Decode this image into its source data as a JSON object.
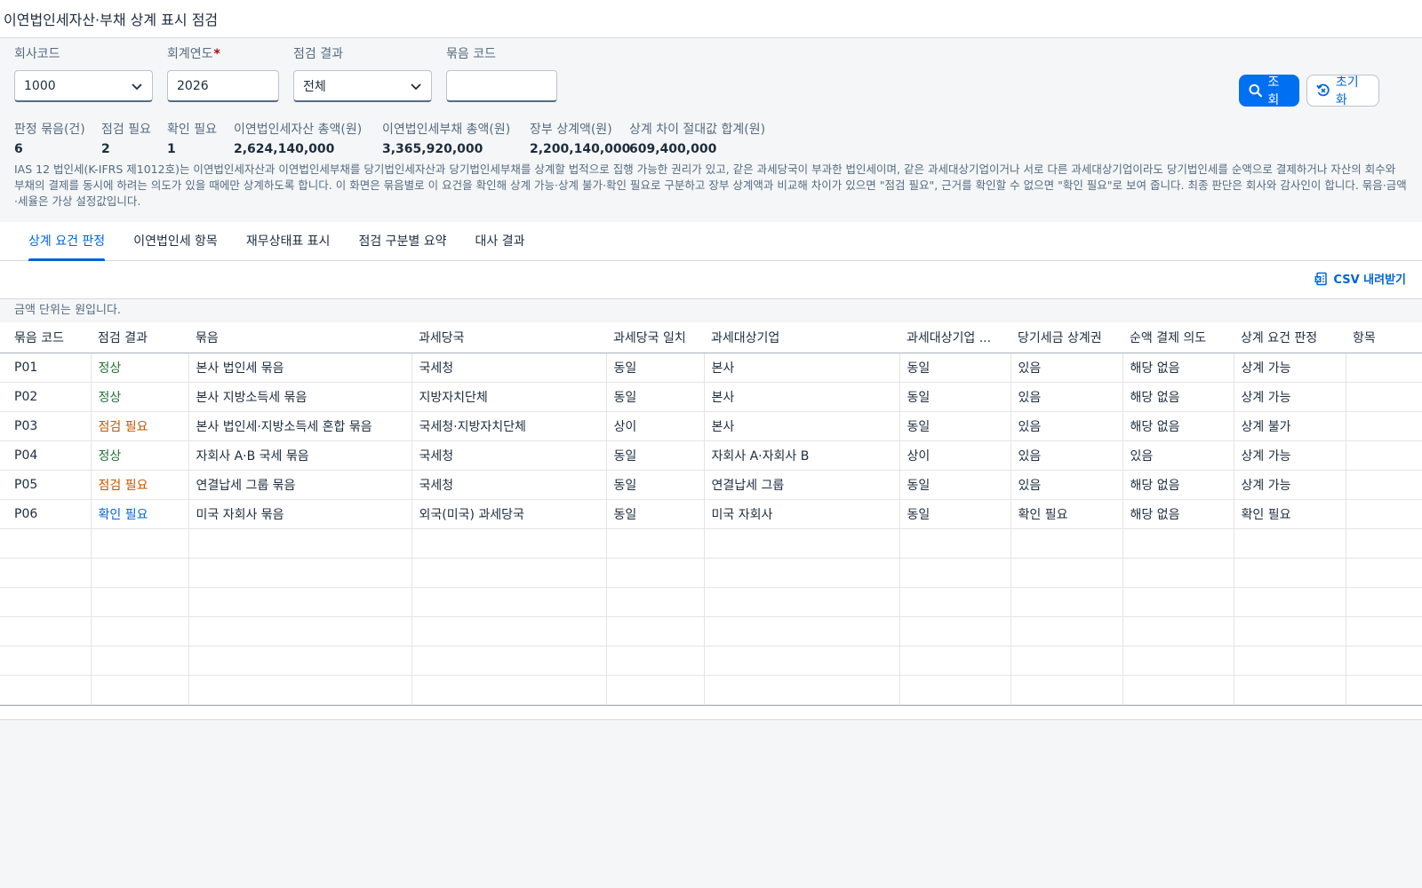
{
  "title": "이연법인세자산·부채 상계 표시 점검",
  "filters": {
    "company_code": {
      "label": "회사코드",
      "value": "1000"
    },
    "fiscal_year": {
      "label": "회계연도",
      "required_mark": "*",
      "value": "2026"
    },
    "check_result": {
      "label": "점검 결과",
      "value": "전체"
    },
    "group_code": {
      "label": "묶음 코드",
      "value": ""
    }
  },
  "buttons": {
    "search": "조회",
    "reset": "초기화"
  },
  "kpis": [
    {
      "label": "판정 묶음(건)",
      "value": "6"
    },
    {
      "label": "점검 필요",
      "value": "2"
    },
    {
      "label": "확인 필요",
      "value": "1"
    },
    {
      "label": "이연법인세자산 총액(원)",
      "value": "2,624,140,000"
    },
    {
      "label": "이연법인세부채 총액(원)",
      "value": "3,365,920,000"
    },
    {
      "label": "장부 상계액(원)",
      "value": "2,200,140,000"
    },
    {
      "label": "상계 차이 절대값 합계(원)",
      "value": "609,400,000"
    }
  ],
  "note": "IAS 12 법인세(K-IFRS 제1012호)는 이연법인세자산과 이연법인세부채를 당기법인세자산과 당기법인세부채를 상계할 법적으로 집행 가능한 권리가 있고, 같은 과세당국이 부과한 법인세이며, 같은 과세대상기업이거나 서로 다른 과세대상기업이라도 당기법인세를 순액으로 결제하거나 자산의 회수와 부채의 결제를 동시에 하려는 의도가 있을 때에만 상계하도록 합니다. 이 화면은 묶음별로 이 요건을 확인해 상계 가능·상계 불가·확인 필요로 구분하고 장부 상계액과 비교해 차이가 있으면 \"점검 필요\", 근거를 확인할 수 없으면 \"확인 필요\"로 보여 줍니다. 최종 판단은 회사와 감사인이 합니다. 묶음·금액·세율은 가상 설정값입니다.",
  "tabs": [
    "상계 요건 판정",
    "이연법인세 항목",
    "재무상태표 표시",
    "점검 구분별 요약",
    "대사 결과"
  ],
  "toolbar": {
    "csv": "CSV 내려받기"
  },
  "unit_note": "금액 단위는 원입니다.",
  "table": {
    "headers": [
      "묶음 코드",
      "점검 결과",
      "묶음",
      "과세당국",
      "과세당국 일치",
      "과세대상기업",
      "과세대상기업 ...",
      "당기세금 상계권",
      "순액 결제 의도",
      "상계 요건 판정",
      "항목"
    ],
    "rows": [
      [
        "P01",
        "정상",
        "본사 법인세 묶음",
        "국세청",
        "동일",
        "본사",
        "동일",
        "있음",
        "해당 없음",
        "상계 가능",
        ""
      ],
      [
        "P02",
        "정상",
        "본사 지방소득세 묶음",
        "지방자치단체",
        "동일",
        "본사",
        "동일",
        "있음",
        "해당 없음",
        "상계 가능",
        ""
      ],
      [
        "P03",
        "점검 필요",
        "본사 법인세·지방소득세 혼합 묶음",
        "국세청·지방자치단체",
        "상이",
        "본사",
        "동일",
        "있음",
        "해당 없음",
        "상계 불가",
        ""
      ],
      [
        "P04",
        "정상",
        "자회사 A·B 국세 묶음",
        "국세청",
        "동일",
        "자회사 A·자회사 B",
        "상이",
        "있음",
        "있음",
        "상계 가능",
        ""
      ],
      [
        "P05",
        "점검 필요",
        "연결납세 그룹 묶음",
        "국세청",
        "동일",
        "연결납세 그룹",
        "동일",
        "있음",
        "해당 없음",
        "상계 가능",
        ""
      ],
      [
        "P06",
        "확인 필요",
        "미국 자회사 묶음",
        "외국(미국) 과세당국",
        "동일",
        "미국 자회사",
        "동일",
        "확인 필요",
        "해당 없음",
        "확인 필요",
        ""
      ]
    ],
    "empty_rows": 6
  }
}
